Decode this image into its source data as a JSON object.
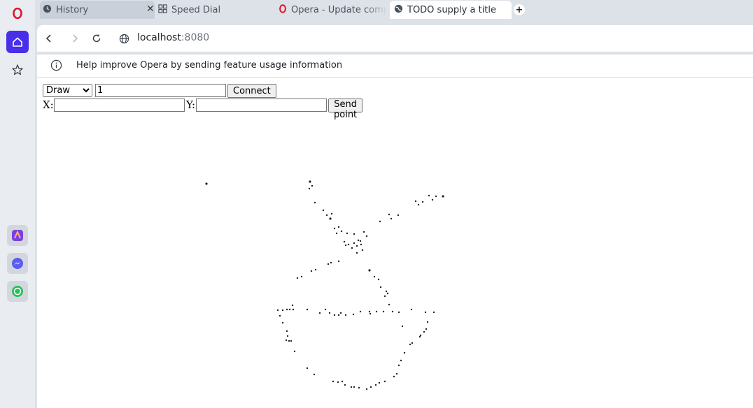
{
  "tabs": [
    {
      "title": "History",
      "icon": "clock-icon"
    },
    {
      "title": "Speed Dial",
      "icon": "grid-icon"
    },
    {
      "title": "Opera - Update complete",
      "icon": "opera-icon"
    },
    {
      "title": "TODO supply a title",
      "icon": "globe-icon"
    }
  ],
  "address": {
    "host": "localhost",
    "port": ":8080"
  },
  "infobar": {
    "message": "Help improve Opera by sending feature usage information"
  },
  "controls": {
    "mode_options": [
      "Draw"
    ],
    "mode_selected": "Draw",
    "room_value": "1",
    "connect_label": "Connect",
    "x_label": "X:",
    "y_label": "Y:",
    "x_value": "",
    "y_value": "",
    "send_label": "Send point"
  },
  "colors": {
    "accent": "#4a2fe8",
    "opera_red": "#e0162b",
    "point": "#222222"
  },
  "sidebar_apps": [
    "aria-icon",
    "messenger-icon",
    "whatsapp-icon"
  ]
}
